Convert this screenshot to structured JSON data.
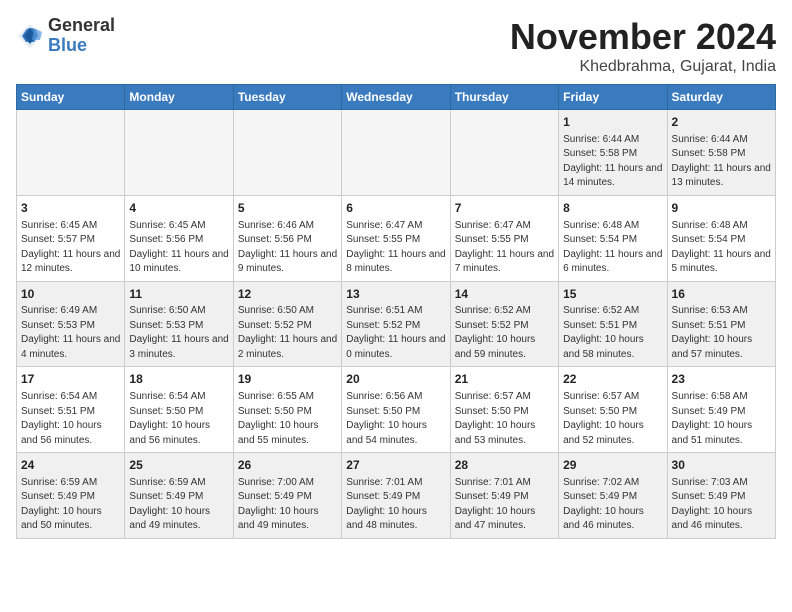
{
  "header": {
    "logo_general": "General",
    "logo_blue": "Blue",
    "month_title": "November 2024",
    "location": "Khedbrahma, Gujarat, India"
  },
  "weekdays": [
    "Sunday",
    "Monday",
    "Tuesday",
    "Wednesday",
    "Thursday",
    "Friday",
    "Saturday"
  ],
  "weeks": [
    [
      {
        "day": "",
        "info": ""
      },
      {
        "day": "",
        "info": ""
      },
      {
        "day": "",
        "info": ""
      },
      {
        "day": "",
        "info": ""
      },
      {
        "day": "",
        "info": ""
      },
      {
        "day": "1",
        "info": "Sunrise: 6:44 AM\nSunset: 5:58 PM\nDaylight: 11 hours and 14 minutes."
      },
      {
        "day": "2",
        "info": "Sunrise: 6:44 AM\nSunset: 5:58 PM\nDaylight: 11 hours and 13 minutes."
      }
    ],
    [
      {
        "day": "3",
        "info": "Sunrise: 6:45 AM\nSunset: 5:57 PM\nDaylight: 11 hours and 12 minutes."
      },
      {
        "day": "4",
        "info": "Sunrise: 6:45 AM\nSunset: 5:56 PM\nDaylight: 11 hours and 10 minutes."
      },
      {
        "day": "5",
        "info": "Sunrise: 6:46 AM\nSunset: 5:56 PM\nDaylight: 11 hours and 9 minutes."
      },
      {
        "day": "6",
        "info": "Sunrise: 6:47 AM\nSunset: 5:55 PM\nDaylight: 11 hours and 8 minutes."
      },
      {
        "day": "7",
        "info": "Sunrise: 6:47 AM\nSunset: 5:55 PM\nDaylight: 11 hours and 7 minutes."
      },
      {
        "day": "8",
        "info": "Sunrise: 6:48 AM\nSunset: 5:54 PM\nDaylight: 11 hours and 6 minutes."
      },
      {
        "day": "9",
        "info": "Sunrise: 6:48 AM\nSunset: 5:54 PM\nDaylight: 11 hours and 5 minutes."
      }
    ],
    [
      {
        "day": "10",
        "info": "Sunrise: 6:49 AM\nSunset: 5:53 PM\nDaylight: 11 hours and 4 minutes."
      },
      {
        "day": "11",
        "info": "Sunrise: 6:50 AM\nSunset: 5:53 PM\nDaylight: 11 hours and 3 minutes."
      },
      {
        "day": "12",
        "info": "Sunrise: 6:50 AM\nSunset: 5:52 PM\nDaylight: 11 hours and 2 minutes."
      },
      {
        "day": "13",
        "info": "Sunrise: 6:51 AM\nSunset: 5:52 PM\nDaylight: 11 hours and 0 minutes."
      },
      {
        "day": "14",
        "info": "Sunrise: 6:52 AM\nSunset: 5:52 PM\nDaylight: 10 hours and 59 minutes."
      },
      {
        "day": "15",
        "info": "Sunrise: 6:52 AM\nSunset: 5:51 PM\nDaylight: 10 hours and 58 minutes."
      },
      {
        "day": "16",
        "info": "Sunrise: 6:53 AM\nSunset: 5:51 PM\nDaylight: 10 hours and 57 minutes."
      }
    ],
    [
      {
        "day": "17",
        "info": "Sunrise: 6:54 AM\nSunset: 5:51 PM\nDaylight: 10 hours and 56 minutes."
      },
      {
        "day": "18",
        "info": "Sunrise: 6:54 AM\nSunset: 5:50 PM\nDaylight: 10 hours and 56 minutes."
      },
      {
        "day": "19",
        "info": "Sunrise: 6:55 AM\nSunset: 5:50 PM\nDaylight: 10 hours and 55 minutes."
      },
      {
        "day": "20",
        "info": "Sunrise: 6:56 AM\nSunset: 5:50 PM\nDaylight: 10 hours and 54 minutes."
      },
      {
        "day": "21",
        "info": "Sunrise: 6:57 AM\nSunset: 5:50 PM\nDaylight: 10 hours and 53 minutes."
      },
      {
        "day": "22",
        "info": "Sunrise: 6:57 AM\nSunset: 5:50 PM\nDaylight: 10 hours and 52 minutes."
      },
      {
        "day": "23",
        "info": "Sunrise: 6:58 AM\nSunset: 5:49 PM\nDaylight: 10 hours and 51 minutes."
      }
    ],
    [
      {
        "day": "24",
        "info": "Sunrise: 6:59 AM\nSunset: 5:49 PM\nDaylight: 10 hours and 50 minutes."
      },
      {
        "day": "25",
        "info": "Sunrise: 6:59 AM\nSunset: 5:49 PM\nDaylight: 10 hours and 49 minutes."
      },
      {
        "day": "26",
        "info": "Sunrise: 7:00 AM\nSunset: 5:49 PM\nDaylight: 10 hours and 49 minutes."
      },
      {
        "day": "27",
        "info": "Sunrise: 7:01 AM\nSunset: 5:49 PM\nDaylight: 10 hours and 48 minutes."
      },
      {
        "day": "28",
        "info": "Sunrise: 7:01 AM\nSunset: 5:49 PM\nDaylight: 10 hours and 47 minutes."
      },
      {
        "day": "29",
        "info": "Sunrise: 7:02 AM\nSunset: 5:49 PM\nDaylight: 10 hours and 46 minutes."
      },
      {
        "day": "30",
        "info": "Sunrise: 7:03 AM\nSunset: 5:49 PM\nDaylight: 10 hours and 46 minutes."
      }
    ]
  ]
}
